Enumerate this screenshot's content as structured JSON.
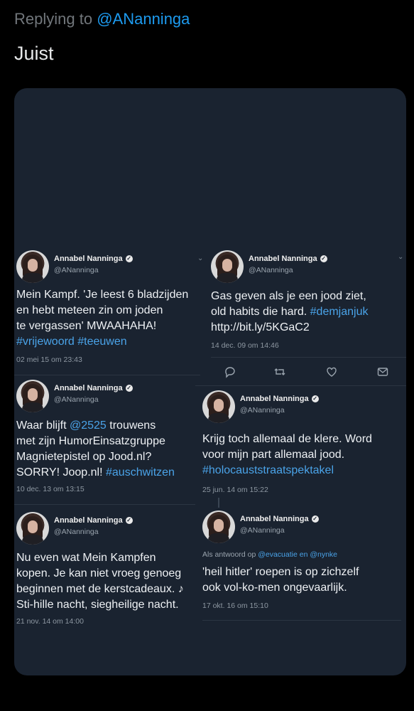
{
  "reply_header": {
    "prefix": "Replying to",
    "mention": "@ANanninga"
  },
  "reply_text": "Juist",
  "tweets": [
    {
      "name": "Annabel Nanninga",
      "handle": "@ANanninga",
      "lines": [
        {
          "text": "Mein Kampf. 'Je leest 6 bladzijden"
        },
        {
          "text": "en hebt meteen zin om joden"
        },
        {
          "text": "te vergassen' MWAAHAHA!"
        },
        {
          "text": "",
          "tags": [
            "#vrijewoord",
            "#teeuwen"
          ]
        }
      ],
      "time": "02 mei 15 om 23:43"
    },
    {
      "name": "Annabel Nanninga",
      "handle": "@ANanninga",
      "lines": [
        {
          "text": "Gas geven als je een jood ziet,"
        },
        {
          "text": "old habits die hard.",
          "tag": "#demjanjuk"
        },
        {
          "text": "http://bit.ly/5KGaC2"
        }
      ],
      "time": "14 dec. 09 om 14:46"
    },
    {
      "name": "Annabel Nanninga",
      "handle": "@ANanninga",
      "lines": [
        {
          "pre": "Waar blijft ",
          "tag": "@2525",
          "post": " trouwens"
        },
        {
          "text": "met zijn HumorEinsatzgruppe"
        },
        {
          "text": "Magnietepistel op Jood.nl?"
        },
        {
          "text": "SORRY! Joop.nl!",
          "tag": "#auschwitzen"
        }
      ],
      "time": "10 dec. 13 om 13:15"
    },
    {
      "name": "Annabel Nanninga",
      "handle": "@ANanninga",
      "lines": [
        {
          "text": "Krijg toch allemaal de klere. Word"
        },
        {
          "text": "voor mijn part allemaal jood."
        },
        {
          "text": "",
          "tag": "#holocauststraatspektakel"
        }
      ],
      "time": "25 jun. 14 om 15:22"
    },
    {
      "name": "Annabel Nanninga",
      "handle": "@ANanninga",
      "lines": [
        {
          "text": "Nu even wat Mein Kampfen"
        },
        {
          "text": "kopen. Je kan niet vroeg genoeg"
        },
        {
          "text": "beginnen met de kerstcadeaux. ♪"
        },
        {
          "text": "Sti-hille nacht, siegheilige nacht."
        }
      ],
      "time": "21 nov. 14 om 14:00"
    },
    {
      "name": "Annabel Nanninga",
      "handle": "@ANanninga",
      "reply_context": {
        "prefix": "Als antwoord op",
        "mentions": "@evacuatie en @nynke"
      },
      "lines": [
        {
          "text": "'heil hitler' roepen is op zichzelf"
        },
        {
          "text": "ook vol-ko-men ongevaarlijk."
        }
      ],
      "time": "17 okt. 16 om 15:10"
    }
  ],
  "icons": [
    "reply-icon",
    "retweet-icon",
    "like-icon",
    "dm-icon",
    "verified-icon",
    "chevron-down-icon"
  ],
  "colors": {
    "background": "#000000",
    "card": "#1a2330",
    "accent": "#1d9bf0",
    "hashtag": "#4aa3e8"
  }
}
